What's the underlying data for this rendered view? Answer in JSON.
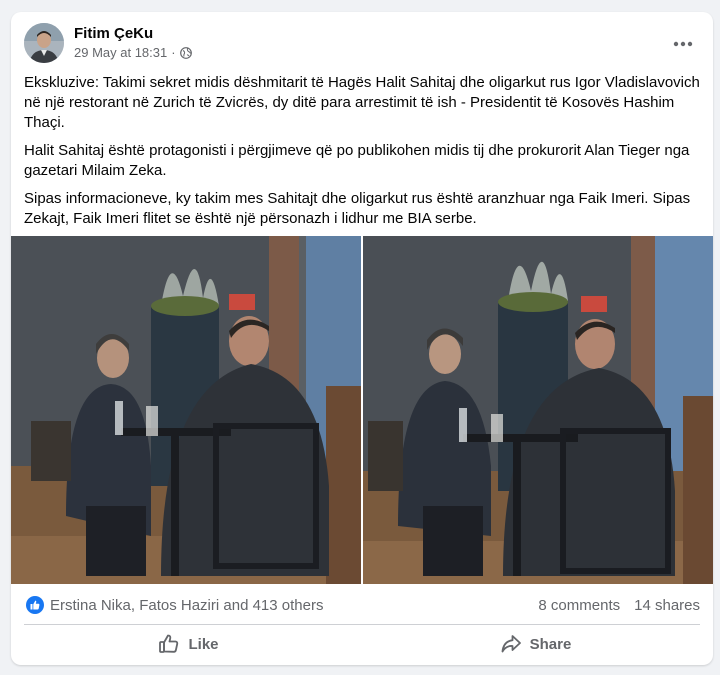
{
  "post": {
    "author": "Fitim ÇeKu",
    "date": "29 May at 18:31",
    "separator": "·",
    "privacy_icon": "globe-icon",
    "more_icon": "more-options-icon",
    "paragraphs": [
      "Ekskluzive: Takimi sekret midis dëshmitarit të Hagës Halit Sahitaj dhe oligarkut rus Igor Vladislavovich në një restorant në Zurich të Zvicrës, dy ditë para arrestimit të ish - Presidentit të Kosovës Hashim Thaçi.",
      "Halit Sahitaj është protagonisti i përgjimeve që po publikohen midis tij dhe prokurorit Alan Tieger nga gazetari Milaim Zeka.",
      "Sipas informacioneve, ky takim mes Sahitajt dhe oligarkut rus është aranzhuar nga Faik Imeri. Sipas Zekajt, Faik Imeri flitet se është një përsonazh i lidhur me BIA serbe."
    ]
  },
  "engagement": {
    "reaction_icon": "like-reaction-icon",
    "reaction_names": "Erstina Nika, Fatos Haziri and 413 others",
    "comments": "8 comments",
    "shares": "14 shares"
  },
  "actions": {
    "like_label": "Like",
    "share_label": "Share"
  },
  "colors": {
    "accent": "#1877f2",
    "secondary_text": "#65676b",
    "background": "#f0f2f5"
  }
}
